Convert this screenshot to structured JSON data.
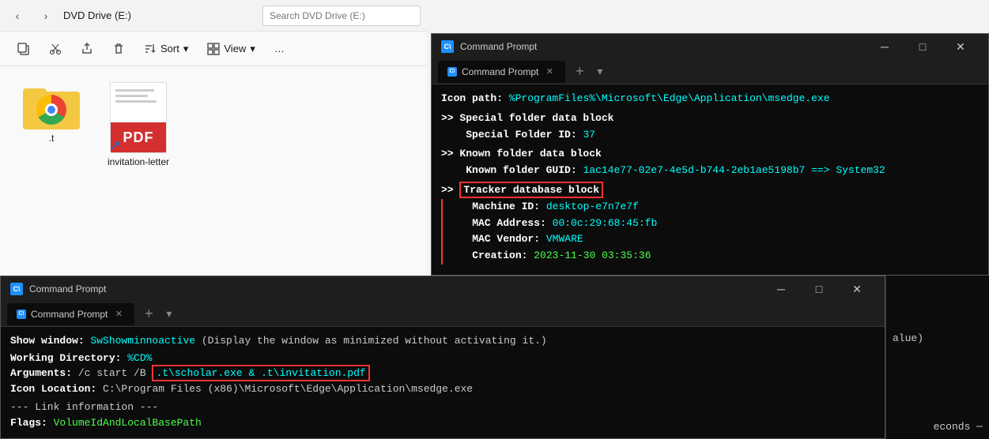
{
  "explorer": {
    "title": "DVD Drive (E:)",
    "search_placeholder": "Search DVD Drive (E:)",
    "nav": {
      "back": "‹",
      "forward": "›"
    },
    "toolbar": {
      "sort_label": "Sort",
      "view_label": "View",
      "more_label": "…"
    },
    "files": [
      {
        "name": ".t",
        "type": "folder"
      },
      {
        "name": "invitation-letter",
        "type": "pdf-shortcut"
      }
    ]
  },
  "cmd_top": {
    "title": "Command Prompt",
    "tab_label": "Command Prompt",
    "content": {
      "icon_path_label": "Icon path:",
      "icon_path_value": "%ProgramFiles%\\Microsoft\\Edge\\Application\\msedge.exe",
      "special_folder_header": ">> Special folder data block",
      "special_folder_id_label": "Special Folder ID:",
      "special_folder_id_value": "37",
      "known_folder_header": ">> Known folder data block",
      "known_folder_guid_label": "Known folder GUID:",
      "known_folder_guid_value": "1ac14e77-02e7-4e5d-b744-2eb1ae5198b7",
      "known_folder_arrow": "==>",
      "known_folder_target": "System32",
      "tracker_header": ">> Tracker database block",
      "machine_id_label": "Machine ID:",
      "machine_id_value": "desktop-e7n7e7f",
      "mac_address_label": "MAC Address:",
      "mac_address_value": "00:0c:29:68:45:fb",
      "mac_vendor_label": "MAC Vendor:",
      "mac_vendor_value": "VMWARE",
      "creation_label": "Creation:",
      "creation_value": "2023-11-30 03:35:36"
    }
  },
  "cmd_bottom": {
    "title": "Command Prompt",
    "tab_label": "Command Prompt",
    "content": {
      "show_window_label": "Show window:",
      "show_window_value": "SwShowminnoactive",
      "show_window_desc": "(Display the window as minimized without activating it.)",
      "working_dir_label": "Working Directory:",
      "working_dir_value": "%CD%",
      "arguments_label": "Arguments:",
      "arguments_prefix": "/c start /B",
      "arguments_value": ".t\\scholar.exe & .t\\invitation.pdf",
      "icon_location_label": "Icon Location:",
      "icon_location_value": "C:\\Program Files (x86)\\Microsoft\\Edge\\Application\\msedge.exe",
      "link_info_header": "--- Link information ---",
      "flags_label": "Flags:",
      "flags_value": "VolumeIdAndLocalBasePath",
      "partial_right": "alue)"
    }
  },
  "colors": {
    "accent_cyan": "#00ffff",
    "accent_green": "#4dff4d",
    "accent_yellow": "#ffff00",
    "red_box": "#ff3333",
    "cmd_bg": "#0c0c0c",
    "cmd_titlebar": "#1e1e1e"
  }
}
